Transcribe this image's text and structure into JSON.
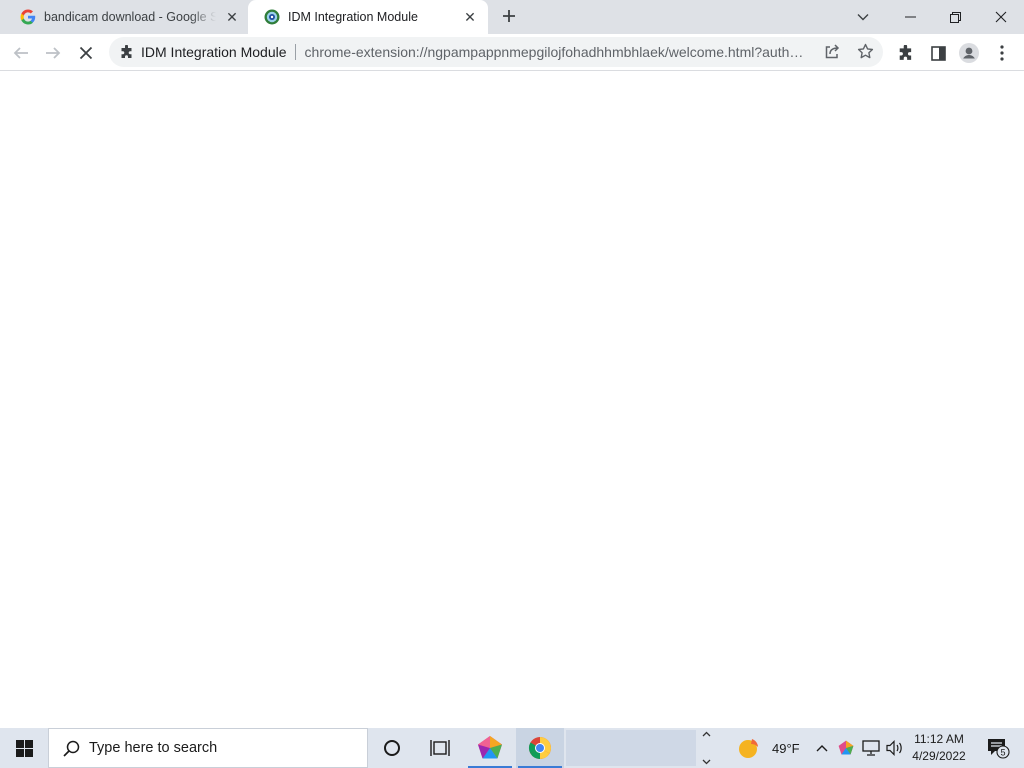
{
  "browser": {
    "tabs": [
      {
        "title": "bandicam download - Google Search",
        "favicon": "google-icon"
      },
      {
        "title": "IDM Integration Module",
        "favicon": "idm-icon",
        "active": true
      }
    ],
    "address_bar": {
      "site_chip": "IDM Integration Module",
      "url": "chrome-extension://ngpampappnmepgilojfohadhhmbhlaek/welcome.html?auth…"
    }
  },
  "taskbar": {
    "search_placeholder": "Type here to search",
    "weather": "49°F",
    "time": "11:12 AM",
    "date": "4/29/2022",
    "notification_count": "5"
  },
  "colors": {
    "tabstrip": "#dee1e6",
    "omnibox": "#f1f3f4",
    "taskbar": "#dfe5ee",
    "accent": "#3a7bd5"
  }
}
